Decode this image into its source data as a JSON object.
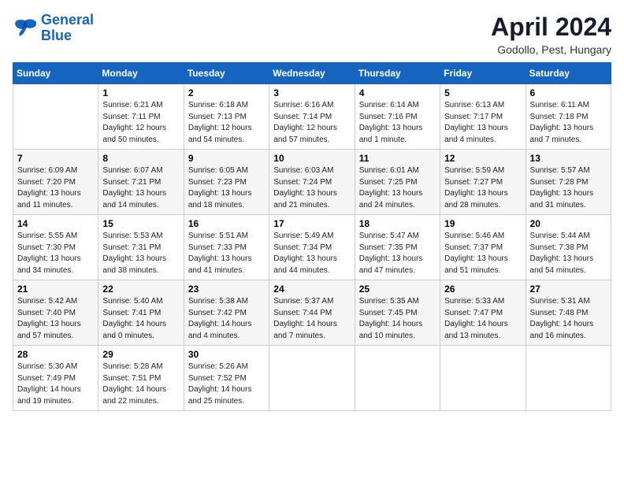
{
  "header": {
    "logo_line1": "General",
    "logo_line2": "Blue",
    "month": "April 2024",
    "location": "Godollo, Pest, Hungary"
  },
  "weekdays": [
    "Sunday",
    "Monday",
    "Tuesday",
    "Wednesday",
    "Thursday",
    "Friday",
    "Saturday"
  ],
  "weeks": [
    [
      {
        "day": "",
        "sunrise": "",
        "sunset": "",
        "daylight": ""
      },
      {
        "day": "1",
        "sunrise": "Sunrise: 6:21 AM",
        "sunset": "Sunset: 7:11 PM",
        "daylight": "Daylight: 12 hours and 50 minutes."
      },
      {
        "day": "2",
        "sunrise": "Sunrise: 6:18 AM",
        "sunset": "Sunset: 7:13 PM",
        "daylight": "Daylight: 12 hours and 54 minutes."
      },
      {
        "day": "3",
        "sunrise": "Sunrise: 6:16 AM",
        "sunset": "Sunset: 7:14 PM",
        "daylight": "Daylight: 12 hours and 57 minutes."
      },
      {
        "day": "4",
        "sunrise": "Sunrise: 6:14 AM",
        "sunset": "Sunset: 7:16 PM",
        "daylight": "Daylight: 13 hours and 1 minute."
      },
      {
        "day": "5",
        "sunrise": "Sunrise: 6:13 AM",
        "sunset": "Sunset: 7:17 PM",
        "daylight": "Daylight: 13 hours and 4 minutes."
      },
      {
        "day": "6",
        "sunrise": "Sunrise: 6:11 AM",
        "sunset": "Sunset: 7:18 PM",
        "daylight": "Daylight: 13 hours and 7 minutes."
      }
    ],
    [
      {
        "day": "7",
        "sunrise": "Sunrise: 6:09 AM",
        "sunset": "Sunset: 7:20 PM",
        "daylight": "Daylight: 13 hours and 11 minutes."
      },
      {
        "day": "8",
        "sunrise": "Sunrise: 6:07 AM",
        "sunset": "Sunset: 7:21 PM",
        "daylight": "Daylight: 13 hours and 14 minutes."
      },
      {
        "day": "9",
        "sunrise": "Sunrise: 6:05 AM",
        "sunset": "Sunset: 7:23 PM",
        "daylight": "Daylight: 13 hours and 18 minutes."
      },
      {
        "day": "10",
        "sunrise": "Sunrise: 6:03 AM",
        "sunset": "Sunset: 7:24 PM",
        "daylight": "Daylight: 13 hours and 21 minutes."
      },
      {
        "day": "11",
        "sunrise": "Sunrise: 6:01 AM",
        "sunset": "Sunset: 7:25 PM",
        "daylight": "Daylight: 13 hours and 24 minutes."
      },
      {
        "day": "12",
        "sunrise": "Sunrise: 5:59 AM",
        "sunset": "Sunset: 7:27 PM",
        "daylight": "Daylight: 13 hours and 28 minutes."
      },
      {
        "day": "13",
        "sunrise": "Sunrise: 5:57 AM",
        "sunset": "Sunset: 7:28 PM",
        "daylight": "Daylight: 13 hours and 31 minutes."
      }
    ],
    [
      {
        "day": "14",
        "sunrise": "Sunrise: 5:55 AM",
        "sunset": "Sunset: 7:30 PM",
        "daylight": "Daylight: 13 hours and 34 minutes."
      },
      {
        "day": "15",
        "sunrise": "Sunrise: 5:53 AM",
        "sunset": "Sunset: 7:31 PM",
        "daylight": "Daylight: 13 hours and 38 minutes."
      },
      {
        "day": "16",
        "sunrise": "Sunrise: 5:51 AM",
        "sunset": "Sunset: 7:33 PM",
        "daylight": "Daylight: 13 hours and 41 minutes."
      },
      {
        "day": "17",
        "sunrise": "Sunrise: 5:49 AM",
        "sunset": "Sunset: 7:34 PM",
        "daylight": "Daylight: 13 hours and 44 minutes."
      },
      {
        "day": "18",
        "sunrise": "Sunrise: 5:47 AM",
        "sunset": "Sunset: 7:35 PM",
        "daylight": "Daylight: 13 hours and 47 minutes."
      },
      {
        "day": "19",
        "sunrise": "Sunrise: 5:46 AM",
        "sunset": "Sunset: 7:37 PM",
        "daylight": "Daylight: 13 hours and 51 minutes."
      },
      {
        "day": "20",
        "sunrise": "Sunrise: 5:44 AM",
        "sunset": "Sunset: 7:38 PM",
        "daylight": "Daylight: 13 hours and 54 minutes."
      }
    ],
    [
      {
        "day": "21",
        "sunrise": "Sunrise: 5:42 AM",
        "sunset": "Sunset: 7:40 PM",
        "daylight": "Daylight: 13 hours and 57 minutes."
      },
      {
        "day": "22",
        "sunrise": "Sunrise: 5:40 AM",
        "sunset": "Sunset: 7:41 PM",
        "daylight": "Daylight: 14 hours and 0 minutes."
      },
      {
        "day": "23",
        "sunrise": "Sunrise: 5:38 AM",
        "sunset": "Sunset: 7:42 PM",
        "daylight": "Daylight: 14 hours and 4 minutes."
      },
      {
        "day": "24",
        "sunrise": "Sunrise: 5:37 AM",
        "sunset": "Sunset: 7:44 PM",
        "daylight": "Daylight: 14 hours and 7 minutes."
      },
      {
        "day": "25",
        "sunrise": "Sunrise: 5:35 AM",
        "sunset": "Sunset: 7:45 PM",
        "daylight": "Daylight: 14 hours and 10 minutes."
      },
      {
        "day": "26",
        "sunrise": "Sunrise: 5:33 AM",
        "sunset": "Sunset: 7:47 PM",
        "daylight": "Daylight: 14 hours and 13 minutes."
      },
      {
        "day": "27",
        "sunrise": "Sunrise: 5:31 AM",
        "sunset": "Sunset: 7:48 PM",
        "daylight": "Daylight: 14 hours and 16 minutes."
      }
    ],
    [
      {
        "day": "28",
        "sunrise": "Sunrise: 5:30 AM",
        "sunset": "Sunset: 7:49 PM",
        "daylight": "Daylight: 14 hours and 19 minutes."
      },
      {
        "day": "29",
        "sunrise": "Sunrise: 5:28 AM",
        "sunset": "Sunset: 7:51 PM",
        "daylight": "Daylight: 14 hours and 22 minutes."
      },
      {
        "day": "30",
        "sunrise": "Sunrise: 5:26 AM",
        "sunset": "Sunset: 7:52 PM",
        "daylight": "Daylight: 14 hours and 25 minutes."
      },
      {
        "day": "",
        "sunrise": "",
        "sunset": "",
        "daylight": ""
      },
      {
        "day": "",
        "sunrise": "",
        "sunset": "",
        "daylight": ""
      },
      {
        "day": "",
        "sunrise": "",
        "sunset": "",
        "daylight": ""
      },
      {
        "day": "",
        "sunrise": "",
        "sunset": "",
        "daylight": ""
      }
    ]
  ]
}
